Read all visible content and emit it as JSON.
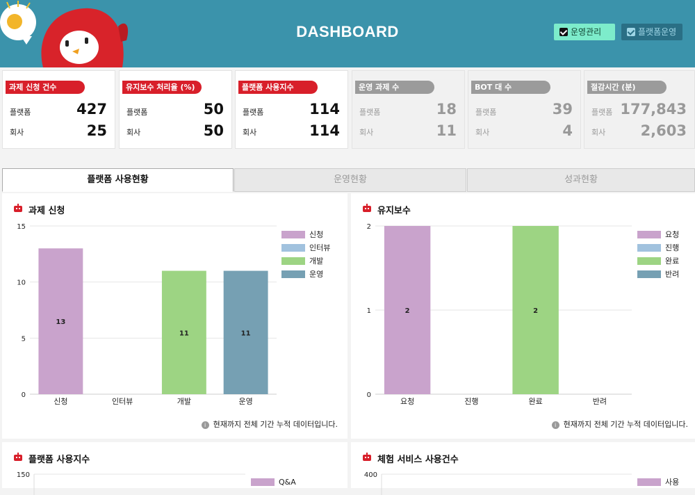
{
  "header": {
    "title": "DASHBOARD",
    "btn_ops": "운영관리",
    "btn_plat": "플랫폼운영"
  },
  "stats": [
    {
      "label": "과제 신청 건수",
      "row1_key": "플랫폼",
      "row1_val": "427",
      "row2_key": "회사",
      "row2_val": "25",
      "dim": false
    },
    {
      "label": "유지보수 처리율 (%)",
      "row1_key": "플랫폼",
      "row1_val": "50",
      "row2_key": "회사",
      "row2_val": "50",
      "dim": false
    },
    {
      "label": "플랫폼 사용지수",
      "row1_key": "플랫폼",
      "row1_val": "114",
      "row2_key": "회사",
      "row2_val": "114",
      "dim": false
    },
    {
      "label": "운영 과제 수",
      "row1_key": "플랫폼",
      "row1_val": "18",
      "row2_key": "회사",
      "row2_val": "11",
      "dim": true
    },
    {
      "label": "BOT 대 수",
      "row1_key": "플랫폼",
      "row1_val": "39",
      "row2_key": "회사",
      "row2_val": "4",
      "dim": true
    },
    {
      "label": "절감시간 (분)",
      "row1_key": "플랫폼",
      "row1_val": "177,843",
      "row2_key": "회사",
      "row2_val": "2,603",
      "dim": true
    }
  ],
  "tabs": [
    "플랫폼 사용현황",
    "운영현황",
    "성과현황"
  ],
  "colors": {
    "pink": "#c9a3cc",
    "lightblue": "#a1c2de",
    "green": "#9dd483",
    "steel": "#76a0b3",
    "red": "#d81f2a",
    "teal": "#3b93ab"
  },
  "panels": {
    "task": {
      "title": "과제 신청",
      "note": "현재까지 전체 기간 누적 데이터입니다.",
      "legend": [
        "신청",
        "인터뷰",
        "개발",
        "운영"
      ]
    },
    "maint": {
      "title": "유지보수",
      "note": "현재까지 전체 기간 누적 데이터입니다.",
      "legend": [
        "요청",
        "진행",
        "완료",
        "반려"
      ]
    },
    "usage": {
      "title": "플랫폼 사용지수",
      "legend": [
        "Q&A"
      ]
    },
    "trial": {
      "title": "체험 서비스 사용건수",
      "legend": [
        "사용"
      ]
    }
  },
  "chart_data": [
    {
      "type": "bar",
      "title": "과제 신청",
      "categories": [
        "신청",
        "인터뷰",
        "개발",
        "운영"
      ],
      "values": [
        13,
        0,
        11,
        11
      ],
      "ylim": [
        0,
        15
      ],
      "yticks": [
        0,
        5,
        10,
        15
      ],
      "legend_position": "right"
    },
    {
      "type": "bar",
      "title": "유지보수",
      "categories": [
        "요청",
        "진행",
        "완료",
        "반려"
      ],
      "values": [
        2,
        0,
        2,
        0
      ],
      "ylim": [
        0,
        2
      ],
      "yticks": [
        0,
        1,
        2
      ],
      "legend_position": "right"
    },
    {
      "type": "bar",
      "title": "플랫폼 사용지수",
      "categories": [],
      "values": [],
      "ylim": [
        0,
        150
      ],
      "yticks": [
        150
      ],
      "legend_position": "right"
    },
    {
      "type": "bar",
      "title": "체험 서비스 사용건수",
      "categories": [],
      "values": [],
      "ylim": [
        0,
        400
      ],
      "yticks": [
        400
      ],
      "legend_position": "right"
    }
  ]
}
